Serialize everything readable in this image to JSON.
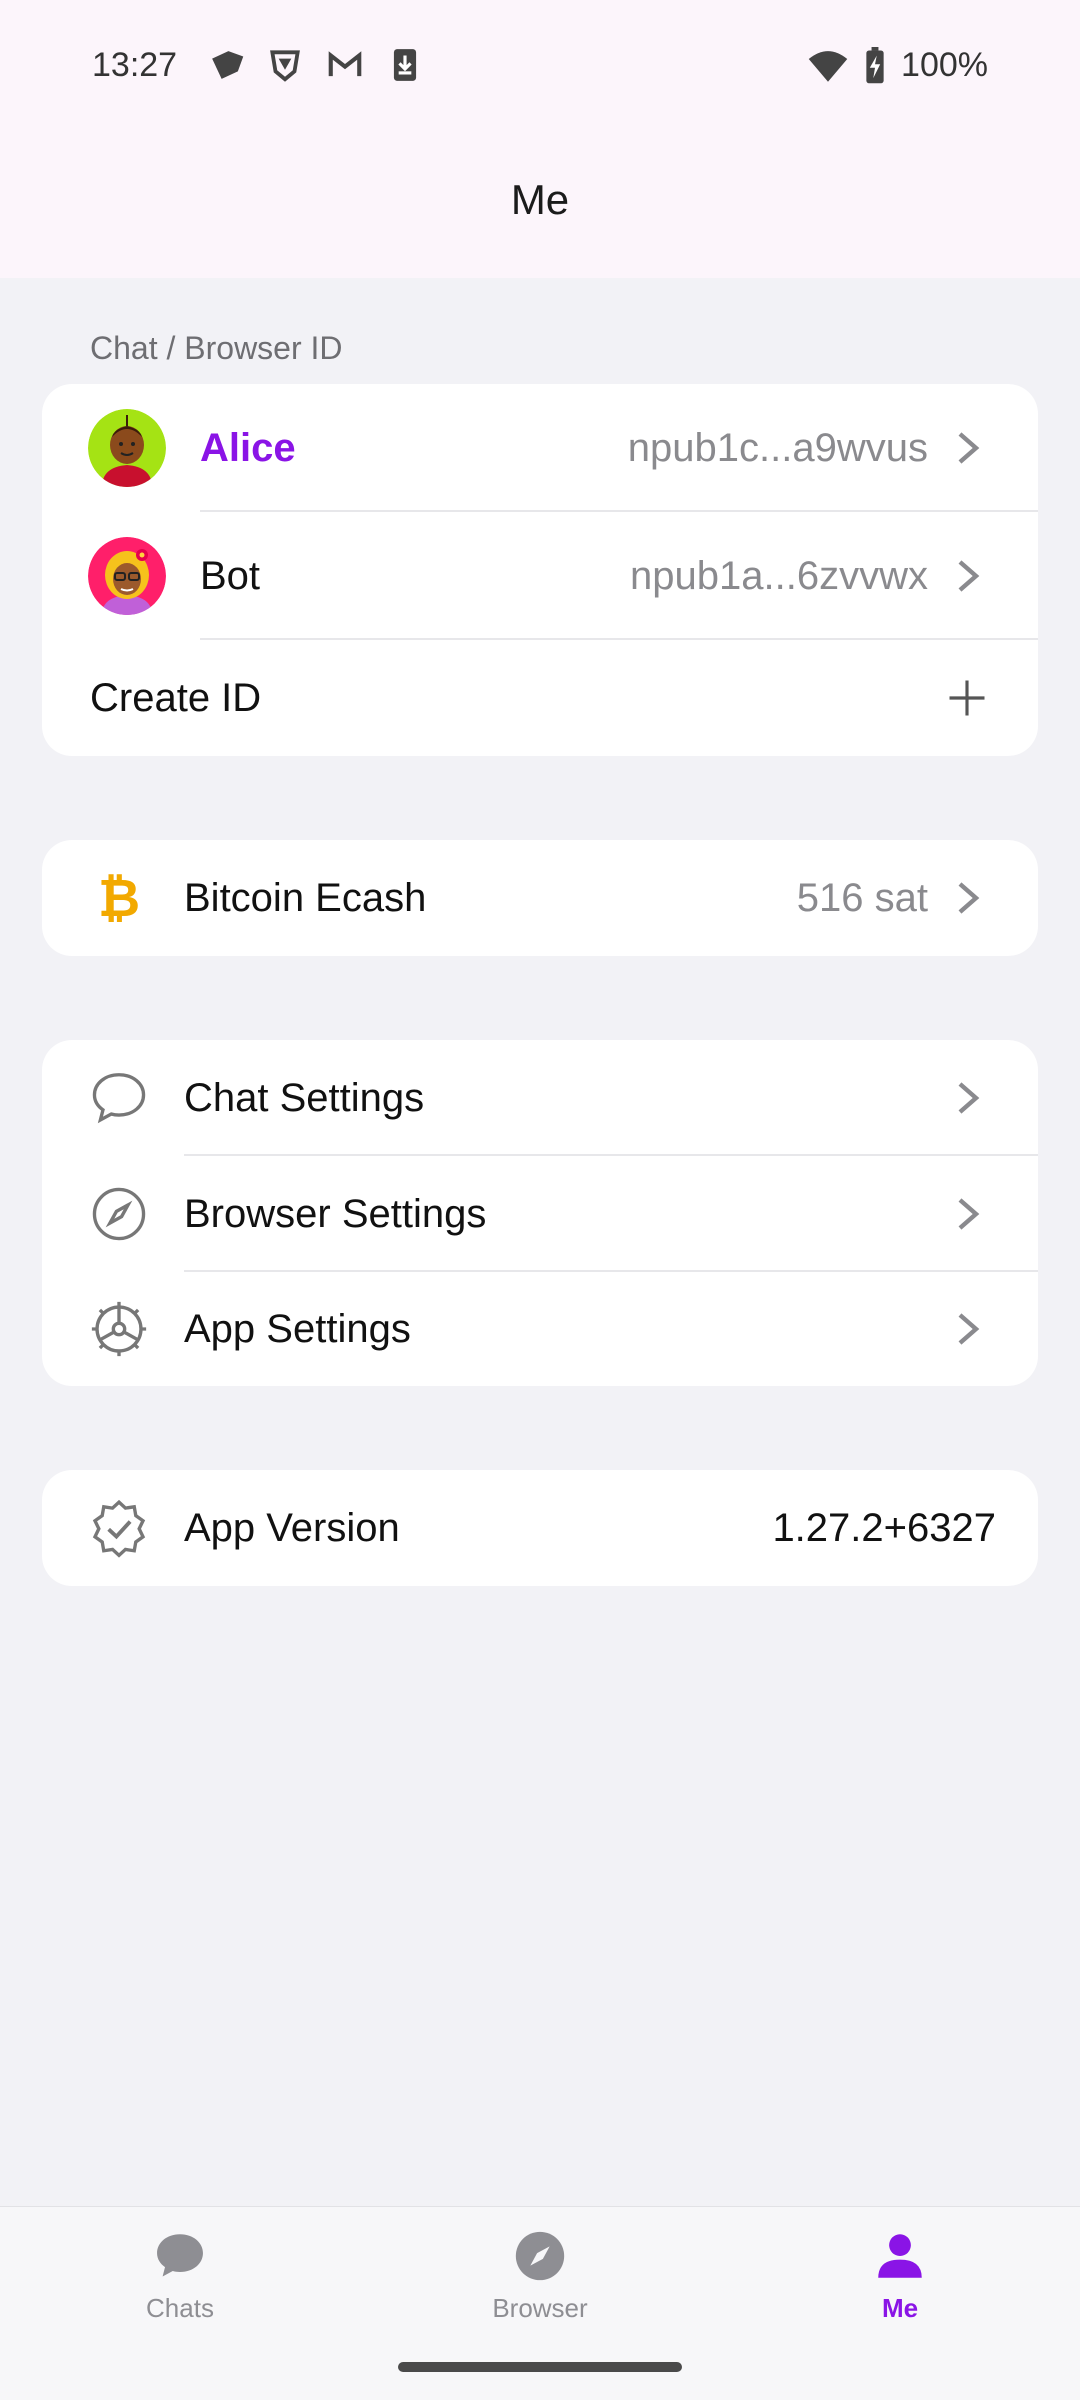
{
  "status_bar": {
    "time": "13:27",
    "battery": "100%",
    "left_icons": [
      "tag-icon",
      "shield-icon",
      "gmail-icon",
      "download-icon"
    ],
    "right_icons": [
      "wifi-icon",
      "battery-charging-icon"
    ]
  },
  "header": {
    "title": "Me"
  },
  "ids_section": {
    "label": "Chat / Browser ID",
    "items": [
      {
        "name": "Alice",
        "npub": "npub1c...a9wvus"
      },
      {
        "name": "Bot",
        "npub": "npub1a...6zvvwx"
      }
    ],
    "create_label": "Create ID"
  },
  "wallet": {
    "label": "Bitcoin Ecash",
    "value": "516 sat"
  },
  "settings": {
    "items": [
      {
        "label": "Chat Settings",
        "icon": "chat-bubble-icon"
      },
      {
        "label": "Browser Settings",
        "icon": "compass-icon"
      },
      {
        "label": "App Settings",
        "icon": "gear-icon"
      }
    ]
  },
  "version": {
    "label": "App Version",
    "value": "1.27.2+6327"
  },
  "bottom_nav": {
    "items": [
      {
        "label": "Chats",
        "icon": "chat-icon"
      },
      {
        "label": "Browser",
        "icon": "compass-icon"
      },
      {
        "label": "Me",
        "icon": "person-icon",
        "active": true
      }
    ]
  },
  "colors": {
    "accent": "#8a14e6",
    "bitcoin": "#f2a900",
    "background": "#f2f2f6"
  }
}
